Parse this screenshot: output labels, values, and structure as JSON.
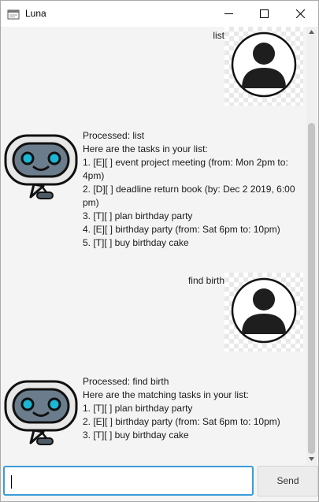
{
  "window": {
    "title": "Luna"
  },
  "conversation": [
    {
      "role": "user",
      "text": "list"
    },
    {
      "role": "bot",
      "lines": [
        "Processed: list",
        "Here are the tasks in your list:",
        "1. [E][ ] event project meeting (from: Mon 2pm to:",
        "4pm)",
        "2. [D][ ] deadline return book (by: Dec 2 2019, 6:00",
        "pm)",
        "3. [T][ ] plan birthday party",
        "4. [E][ ] birthday party (from: Sat 6pm to: 10pm)",
        "5. [T][ ] buy birthday cake"
      ]
    },
    {
      "role": "user",
      "text": "find birth"
    },
    {
      "role": "bot",
      "lines": [
        "Processed: find birth",
        "Here are the matching tasks in your list:",
        "1. [T][ ] plan birthday party",
        "2. [E][ ] birthday party (from: Sat 6pm to: 10pm)",
        "3. [T][ ] buy birthday cake"
      ]
    }
  ],
  "input": {
    "value": "",
    "placeholder": ""
  },
  "send_button": {
    "label": "Send"
  },
  "colors": {
    "input_focus": "#3b9cd9",
    "bot_eye": "#1cb6d4",
    "bot_body": "#6b7d8c"
  }
}
